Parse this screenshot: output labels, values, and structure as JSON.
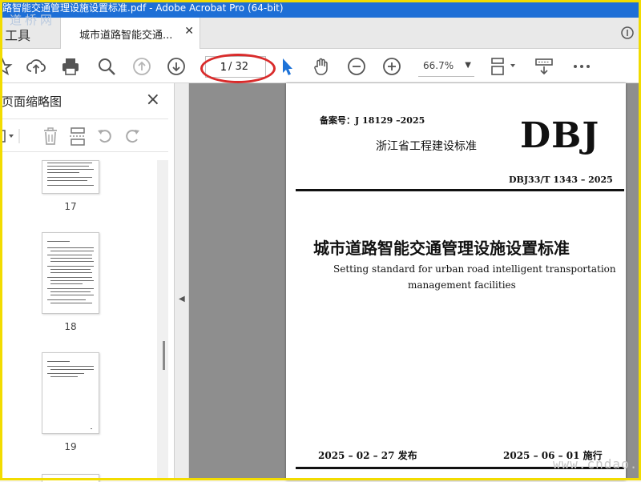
{
  "window": {
    "title": "路智能交通管理设施设置标准.pdf - Adobe Acrobat Pro (64-bit)",
    "watermark_top": "道桥网",
    "watermark_bottom": "www.cndao.com"
  },
  "tabs": {
    "tools_label": "工具",
    "document_tab_label": "城市道路智能交通..."
  },
  "toolbar": {
    "current_page": "1",
    "page_total": "/ 32",
    "zoom": "66.7%",
    "icons": [
      "bookmark-star-icon",
      "upload-cloud-icon",
      "print-icon",
      "zoom-search-icon",
      "previous-page-icon",
      "next-page-icon",
      "select-pointer-icon",
      "hand-tool-icon",
      "zoom-out-icon",
      "zoom-in-icon",
      "page-fit-icon",
      "scroll-mode-icon",
      "more-options-icon"
    ]
  },
  "sidebar": {
    "title": "页面缩略图",
    "thumbnails": [
      {
        "number": "17"
      },
      {
        "number": "18"
      },
      {
        "number": "19"
      }
    ]
  },
  "document": {
    "record_number": "备案号：J 18129 –2025",
    "issuer": "浙江省工程建设标准",
    "logo": "DBJ",
    "standard_code": "DBJ33/T 1343 – 2025",
    "title_cn": "城市道路智能交通管理设施设置标准",
    "title_en_line1": "Setting standard for urban road intelligent transportation",
    "title_en_line2": "management facilities",
    "issue_date": "2025 – 02 – 27 发布",
    "effective_date": "2025 – 06 – 01 施行"
  },
  "colors": {
    "titlebar": "#1e6fd6",
    "frame": "#f2dc00",
    "highlight_ellipse": "#d92b2b",
    "select_tool": "#1e73d8"
  }
}
